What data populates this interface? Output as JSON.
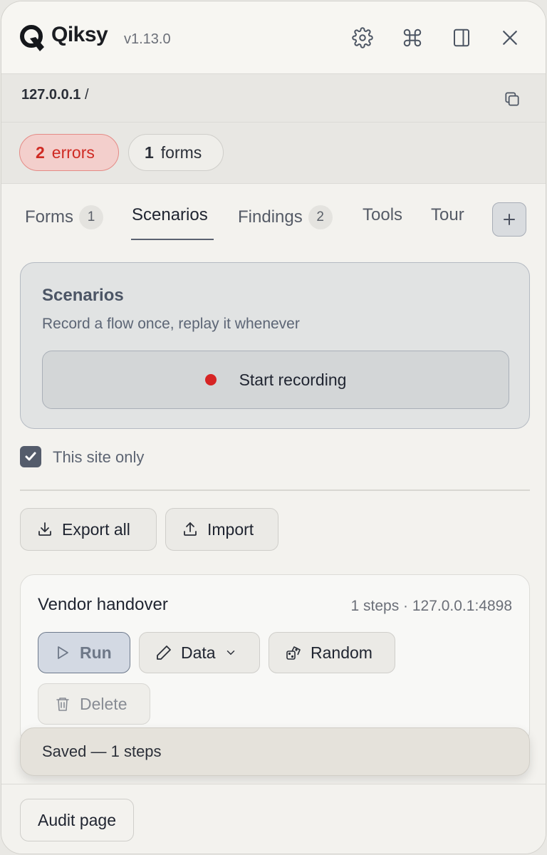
{
  "app": {
    "name": "Qiksy",
    "version": "v1.13.0"
  },
  "header": {
    "icons": [
      "gear-icon",
      "command-icon",
      "sidebar-icon",
      "close-icon"
    ]
  },
  "url": {
    "host": "127.0.0.1",
    "path": "/"
  },
  "badges": {
    "errors": {
      "count": "2",
      "label": "errors",
      "color": "#cf2a23"
    },
    "forms": {
      "count": "1",
      "label": "forms"
    }
  },
  "tabs": [
    {
      "label": "Forms",
      "count": "1"
    },
    {
      "label": "Scenarios",
      "active": true
    },
    {
      "label": "Findings",
      "count": "2"
    },
    {
      "label": "Tools"
    },
    {
      "label": "Tour"
    }
  ],
  "scenarios_card": {
    "title": "Scenarios",
    "subtitle": "Record a flow once, replay it whenever",
    "record_label": "Start recording"
  },
  "site_only": {
    "label": "This site only",
    "checked": true
  },
  "actions": {
    "export_label": "Export all",
    "import_label": "Import"
  },
  "scenario": {
    "name": "Vendor handover",
    "meta": "1 steps · 127.0.0.1:4898",
    "run_label": "Run",
    "data_label": "Data",
    "random_label": "Random",
    "delete_label": "Delete"
  },
  "toast": {
    "text": "Saved — 1 steps"
  },
  "footer": {
    "audit_label": "Audit page"
  }
}
